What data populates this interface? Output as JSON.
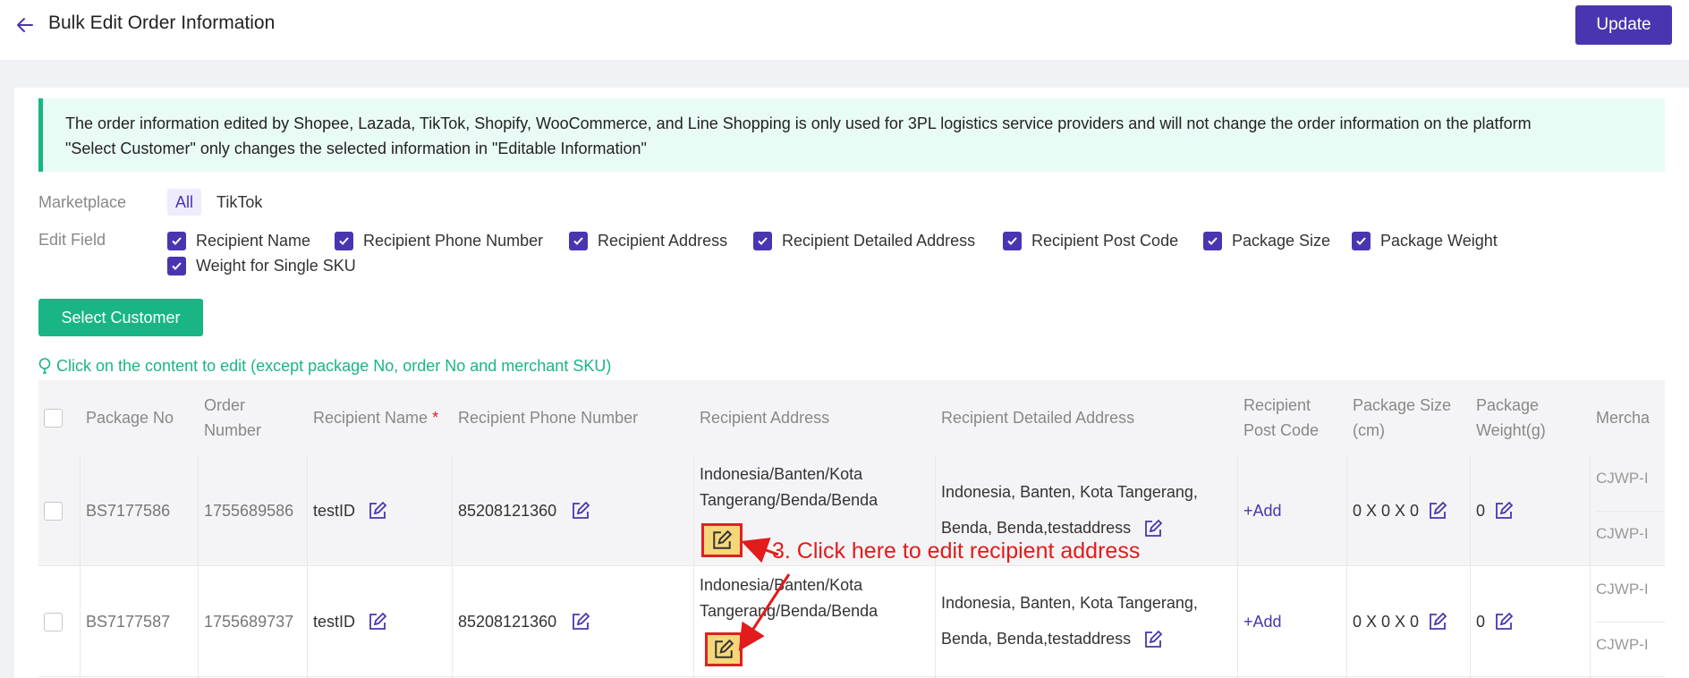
{
  "header": {
    "title": "Bulk Edit Order Information",
    "update_label": "Update"
  },
  "notice": {
    "line1": "The order information edited by Shopee, Lazada, TikTok, Shopify, WooCommerce, and Line Shopping is only used for 3PL logistics service providers and will not change the order information on the platform",
    "line2": "\"Select Customer\" only changes the selected information in \"Editable Information\""
  },
  "filters": {
    "marketplace_label": "Marketplace",
    "marketplace_options": [
      "All",
      "TikTok"
    ],
    "edit_field_label": "Edit Field",
    "edit_fields": [
      "Recipient Name",
      "Recipient Phone Number",
      "Recipient Address",
      "Recipient Detailed Address",
      "Recipient Post Code",
      "Package Size",
      "Package Weight",
      "Weight for Single SKU"
    ]
  },
  "select_customer_label": "Select Customer",
  "hint": "Click on the content to edit (except package No, order No and merchant SKU)",
  "table": {
    "headers": {
      "package_no": "Package No",
      "order_number": "Order Number",
      "recipient_name": "Recipient Name",
      "required_mark": "*",
      "phone": "Recipient Phone Number",
      "address": "Recipient Address",
      "detailed_address": "Recipient Detailed Address",
      "post_code": "Recipient Post Code",
      "package_size": "Package Size (cm)",
      "package_weight": "Package Weight(g)",
      "merchant": "Mercha"
    },
    "rows": [
      {
        "package_no": "BS7177586",
        "order_number": "1755689586",
        "recipient_name": "testID",
        "phone": "85208121360",
        "address": "Indonesia/Banten/Kota Tangerang/Benda/Benda",
        "detailed_address": "Indonesia, Banten, Kota Tangerang, Benda, Benda,testaddress",
        "post_code": "+Add",
        "package_size": "0 X 0 X 0",
        "package_weight": "0",
        "merchant_sku": [
          "CJWP-I",
          "CJWP-I"
        ]
      },
      {
        "package_no": "BS7177587",
        "order_number": "1755689737",
        "recipient_name": "testID",
        "phone": "85208121360",
        "address": "Indonesia/Banten/Kota Tangerang/Benda/Benda",
        "detailed_address": "Indonesia, Banten, Kota Tangerang, Benda, Benda,testaddress",
        "post_code": "+Add",
        "package_size": "0 X 0 X 0",
        "package_weight": "0",
        "merchant_sku": [
          "CJWP-I",
          "CJWP-I"
        ]
      }
    ]
  },
  "annotation": "3. Click here to edit recipient address",
  "colors": {
    "primary": "#4a35b0",
    "success": "#19b585",
    "annotation": "#e21b1b"
  }
}
